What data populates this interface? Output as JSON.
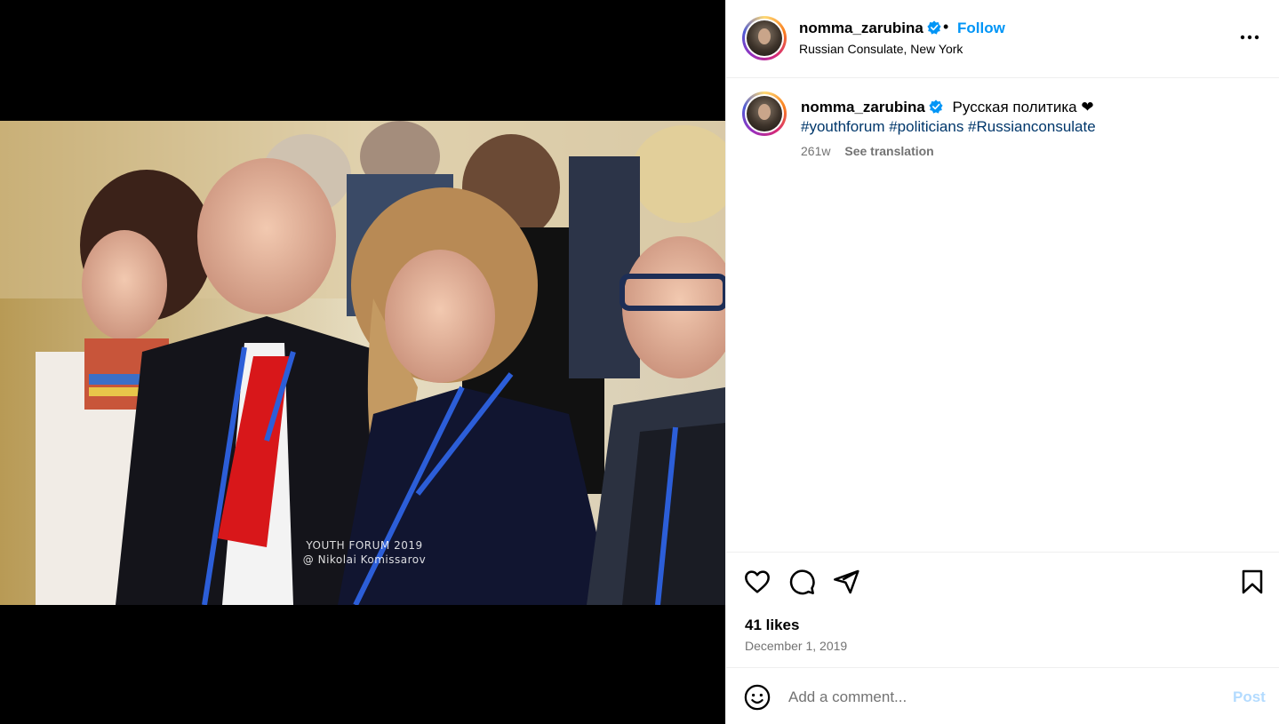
{
  "post": {
    "username": "nomma_zarubina",
    "verified": true,
    "dot": "•",
    "follow_label": "Follow",
    "location": "Russian Consulate, New York"
  },
  "photo": {
    "watermark_line1": "YOUTH FORUM 2019",
    "watermark_line2": "@ Nikolai Komissarov"
  },
  "caption": {
    "username": "nomma_zarubina",
    "text": "Русская политика ❤",
    "hashtags": "#youthforum #politicians #Russianconsulate",
    "age": "261w",
    "see_translation": "See translation"
  },
  "actions": {
    "like_icon": "heart-icon",
    "comment_icon": "comment-icon",
    "share_icon": "send-icon",
    "save_icon": "bookmark-icon",
    "likes_text": "41 likes",
    "date": "December 1, 2019"
  },
  "comment_box": {
    "emoji_icon": "smiley-icon",
    "placeholder": "Add a comment...",
    "post_label": "Post"
  },
  "colors": {
    "accent": "#0095f6",
    "hashtag": "#00376b",
    "muted": "#737373",
    "post_disabled": "#b3dbff"
  }
}
